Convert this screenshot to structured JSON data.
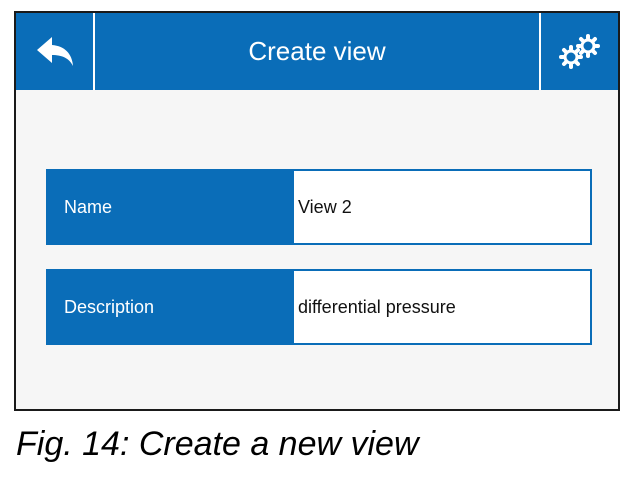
{
  "header": {
    "title": "Create view",
    "back_icon": "back-arrow-icon",
    "settings_icon": "gears-icon"
  },
  "fields": [
    {
      "label": "Name",
      "value": "View 2"
    },
    {
      "label": "Description",
      "value": "differential pressure"
    }
  ],
  "caption": "Fig. 14: Create a new view",
  "colors": {
    "accent": "#0a6db8",
    "background": "#f6f6f6"
  }
}
